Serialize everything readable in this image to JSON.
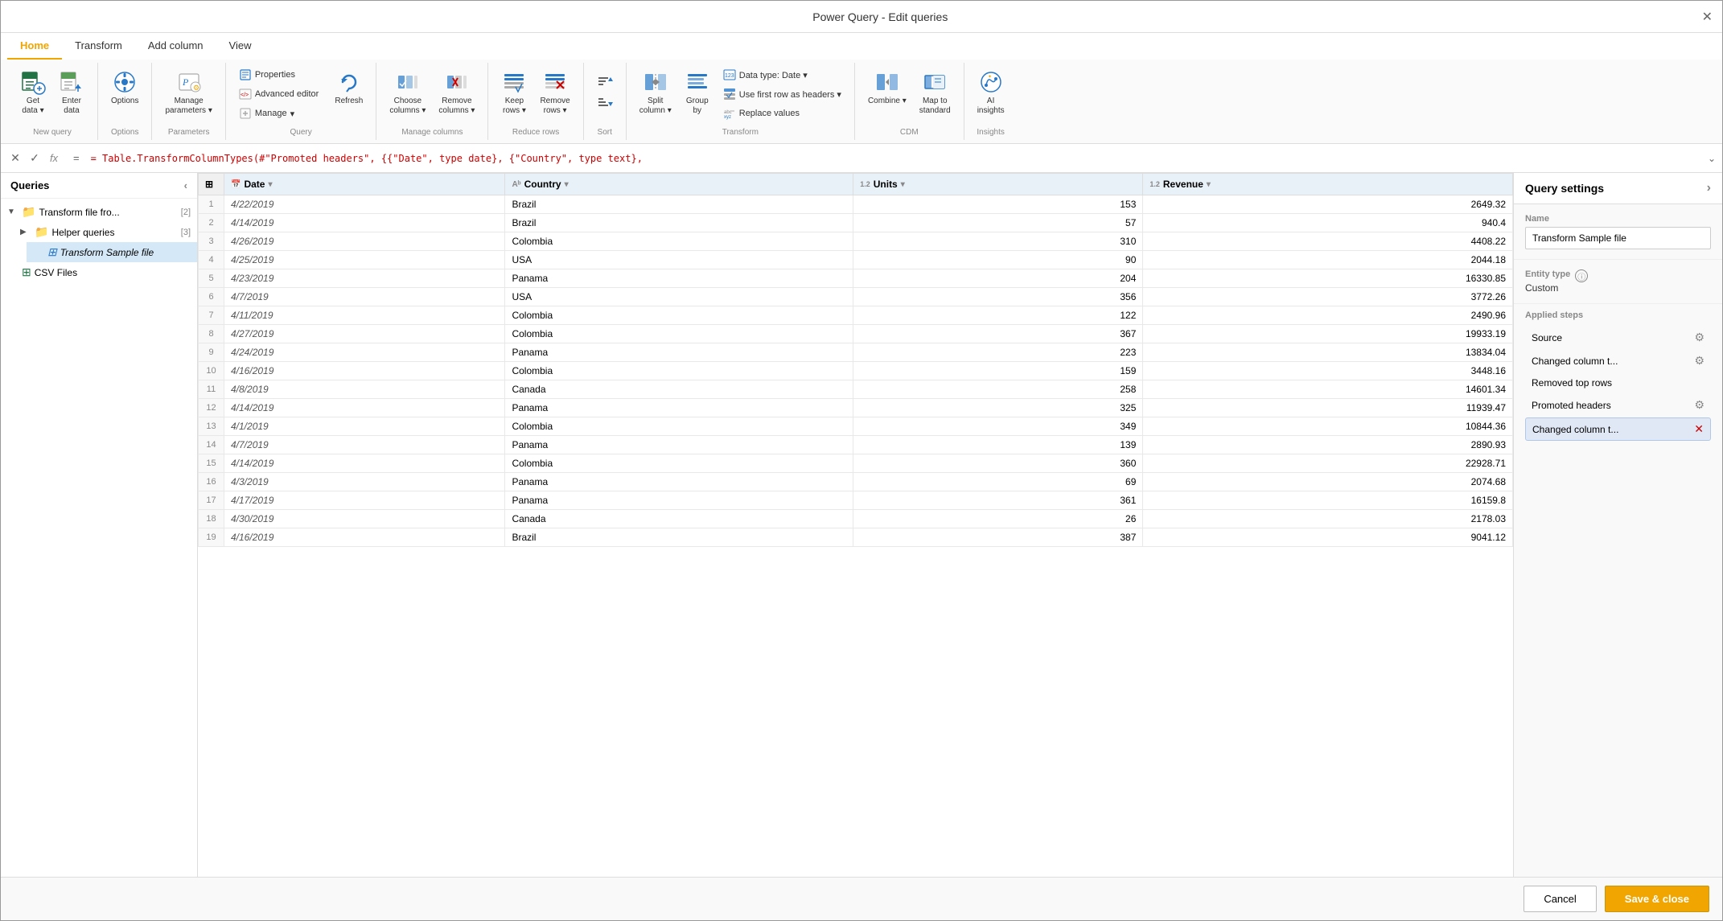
{
  "window": {
    "title": "Power Query - Edit queries",
    "close_label": "✕"
  },
  "tabs": [
    {
      "id": "home",
      "label": "Home",
      "active": true
    },
    {
      "id": "transform",
      "label": "Transform",
      "active": false
    },
    {
      "id": "add_column",
      "label": "Add column",
      "active": false
    },
    {
      "id": "view",
      "label": "View",
      "active": false
    }
  ],
  "ribbon": {
    "groups": [
      {
        "id": "new_query",
        "label": "New query",
        "items": [
          {
            "id": "get_data",
            "label": "Get\ndata",
            "has_arrow": true
          },
          {
            "id": "enter_data",
            "label": "Enter\ndata"
          }
        ]
      },
      {
        "id": "options",
        "label": "Options",
        "items": [
          {
            "id": "options_btn",
            "label": "Options"
          }
        ]
      },
      {
        "id": "parameters",
        "label": "Parameters",
        "items": [
          {
            "id": "manage_params",
            "label": "Manage\nparameters",
            "has_arrow": true
          }
        ]
      },
      {
        "id": "query",
        "label": "Query",
        "items": [
          {
            "id": "properties",
            "label": "Properties"
          },
          {
            "id": "advanced_editor",
            "label": "Advanced editor"
          },
          {
            "id": "manage",
            "label": "Manage",
            "has_arrow": true
          },
          {
            "id": "refresh",
            "label": "Refresh"
          }
        ]
      },
      {
        "id": "manage_columns",
        "label": "Manage columns",
        "items": [
          {
            "id": "choose_columns",
            "label": "Choose\ncolumns",
            "has_arrow": true
          },
          {
            "id": "remove_columns",
            "label": "Remove\ncolumns",
            "has_arrow": true
          }
        ]
      },
      {
        "id": "reduce_rows",
        "label": "Reduce rows",
        "items": [
          {
            "id": "keep_rows",
            "label": "Keep\nrows",
            "has_arrow": true
          },
          {
            "id": "remove_rows",
            "label": "Remove\nrows",
            "has_arrow": true
          }
        ]
      },
      {
        "id": "sort",
        "label": "Sort",
        "items": [
          {
            "id": "sort_asc",
            "label": "↑"
          },
          {
            "id": "sort_desc",
            "label": "↓"
          }
        ]
      },
      {
        "id": "transform",
        "label": "Transform",
        "items": [
          {
            "id": "split_column",
            "label": "Split\ncolumn",
            "has_arrow": true
          },
          {
            "id": "group_by",
            "label": "Group\nby"
          },
          {
            "id": "data_type",
            "label": "Data type: Date"
          },
          {
            "id": "use_first_row",
            "label": "Use first row as headers"
          },
          {
            "id": "replace_values",
            "label": "Replace values"
          }
        ]
      },
      {
        "id": "cdm",
        "label": "CDM",
        "items": [
          {
            "id": "combine",
            "label": "Combine",
            "has_arrow": true
          },
          {
            "id": "map_to_standard",
            "label": "Map to\nstandard"
          }
        ]
      },
      {
        "id": "insights",
        "label": "Insights",
        "items": [
          {
            "id": "ai_insights",
            "label": "AI\ninsights"
          }
        ]
      }
    ]
  },
  "formula_bar": {
    "formula": "= Table.TransformColumnTypes(#\"Promoted headers\", {{\"Date\", type date}, {\"Country\", type text},"
  },
  "sidebar": {
    "title": "Queries",
    "items": [
      {
        "id": "transform_file",
        "label": "Transform file fro...",
        "type": "folder",
        "expanded": true,
        "badge": "2",
        "indent": 0
      },
      {
        "id": "helper_queries",
        "label": "Helper queries",
        "type": "folder",
        "expanded": false,
        "badge": "3",
        "indent": 1
      },
      {
        "id": "transform_sample",
        "label": "Transform Sample file",
        "type": "table",
        "selected": true,
        "italic": true,
        "indent": 2
      },
      {
        "id": "csv_files",
        "label": "CSV Files",
        "type": "table",
        "indent": 0
      }
    ]
  },
  "columns": [
    {
      "id": "row_num",
      "label": "",
      "type": ""
    },
    {
      "id": "date",
      "label": "Date",
      "type": "date"
    },
    {
      "id": "country",
      "label": "Country",
      "type": "text"
    },
    {
      "id": "units",
      "label": "Units",
      "type": "num"
    },
    {
      "id": "revenue",
      "label": "Revenue",
      "type": "num"
    }
  ],
  "rows": [
    {
      "row": 1,
      "date": "4/22/2019",
      "country": "Brazil",
      "units": "153",
      "revenue": "2649.32"
    },
    {
      "row": 2,
      "date": "4/14/2019",
      "country": "Brazil",
      "units": "57",
      "revenue": "940.4"
    },
    {
      "row": 3,
      "date": "4/26/2019",
      "country": "Colombia",
      "units": "310",
      "revenue": "4408.22"
    },
    {
      "row": 4,
      "date": "4/25/2019",
      "country": "USA",
      "units": "90",
      "revenue": "2044.18"
    },
    {
      "row": 5,
      "date": "4/23/2019",
      "country": "Panama",
      "units": "204",
      "revenue": "16330.85"
    },
    {
      "row": 6,
      "date": "4/7/2019",
      "country": "USA",
      "units": "356",
      "revenue": "3772.26"
    },
    {
      "row": 7,
      "date": "4/11/2019",
      "country": "Colombia",
      "units": "122",
      "revenue": "2490.96"
    },
    {
      "row": 8,
      "date": "4/27/2019",
      "country": "Colombia",
      "units": "367",
      "revenue": "19933.19"
    },
    {
      "row": 9,
      "date": "4/24/2019",
      "country": "Panama",
      "units": "223",
      "revenue": "13834.04"
    },
    {
      "row": 10,
      "date": "4/16/2019",
      "country": "Colombia",
      "units": "159",
      "revenue": "3448.16"
    },
    {
      "row": 11,
      "date": "4/8/2019",
      "country": "Canada",
      "units": "258",
      "revenue": "14601.34"
    },
    {
      "row": 12,
      "date": "4/14/2019",
      "country": "Panama",
      "units": "325",
      "revenue": "11939.47"
    },
    {
      "row": 13,
      "date": "4/1/2019",
      "country": "Colombia",
      "units": "349",
      "revenue": "10844.36"
    },
    {
      "row": 14,
      "date": "4/7/2019",
      "country": "Panama",
      "units": "139",
      "revenue": "2890.93"
    },
    {
      "row": 15,
      "date": "4/14/2019",
      "country": "Colombia",
      "units": "360",
      "revenue": "22928.71"
    },
    {
      "row": 16,
      "date": "4/3/2019",
      "country": "Panama",
      "units": "69",
      "revenue": "2074.68"
    },
    {
      "row": 17,
      "date": "4/17/2019",
      "country": "Panama",
      "units": "361",
      "revenue": "16159.8"
    },
    {
      "row": 18,
      "date": "4/30/2019",
      "country": "Canada",
      "units": "26",
      "revenue": "2178.03"
    },
    {
      "row": 19,
      "date": "4/16/2019",
      "country": "Brazil",
      "units": "387",
      "revenue": "9041.12"
    }
  ],
  "query_settings": {
    "title": "Query settings",
    "name_label": "Name",
    "name_value": "Transform Sample file",
    "entity_type_label": "Entity type",
    "entity_type_value": "Custom",
    "applied_steps_label": "Applied steps",
    "steps": [
      {
        "id": "source",
        "label": "Source",
        "has_gear": true,
        "active": false
      },
      {
        "id": "changed_col_t1",
        "label": "Changed column t...",
        "has_gear": true,
        "active": false
      },
      {
        "id": "removed_top_rows",
        "label": "Removed top rows",
        "has_gear": false,
        "active": false
      },
      {
        "id": "promoted_headers",
        "label": "Promoted headers",
        "has_gear": true,
        "active": false
      },
      {
        "id": "changed_col_t2",
        "label": "Changed column t...",
        "has_gear": false,
        "active": true,
        "has_delete": true
      }
    ]
  },
  "bottom_bar": {
    "cancel_label": "Cancel",
    "save_label": "Save & close"
  }
}
